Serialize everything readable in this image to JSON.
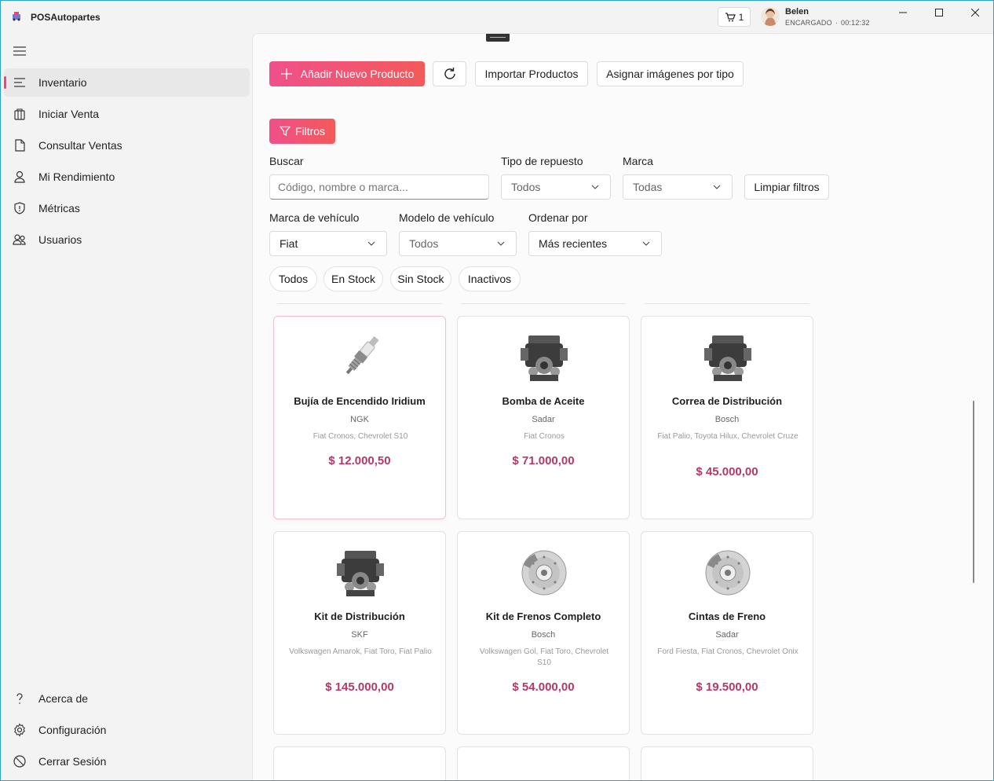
{
  "app": {
    "title": "POSAutopartes"
  },
  "header": {
    "cart_count": "1",
    "user_name": "Belen",
    "user_role": "ENCARGADO",
    "session_time": "00:12:32"
  },
  "sidebar": {
    "items": [
      {
        "label": "Inventario",
        "icon": "list-icon",
        "active": true
      },
      {
        "label": "Iniciar Venta",
        "icon": "bag-icon"
      },
      {
        "label": "Consultar Ventas",
        "icon": "document-icon"
      },
      {
        "label": "Mi Rendimiento",
        "icon": "user-icon"
      },
      {
        "label": "Métricas",
        "icon": "shield-icon"
      },
      {
        "label": "Usuarios",
        "icon": "users-icon"
      }
    ],
    "bottom": [
      {
        "label": "Acerca de",
        "icon": "question-icon"
      },
      {
        "label": "Configuración",
        "icon": "gear-icon"
      },
      {
        "label": "Cerrar Sesión",
        "icon": "logout-icon"
      }
    ]
  },
  "toolbar": {
    "add_label": "Añadir Nuevo Producto",
    "import_label": "Importar Productos",
    "assign_label": "Asignar imágenes por tipo",
    "filters_label": "Filtros"
  },
  "filters": {
    "search_label": "Buscar",
    "search_placeholder": "Código, nombre o marca...",
    "part_type_label": "Tipo de repuesto",
    "part_type_value": "Todos",
    "brand_label": "Marca",
    "brand_value": "Todas",
    "clear_label": "Limpiar filtros",
    "vehicle_brand_label": "Marca de vehículo",
    "vehicle_brand_value": "Fiat",
    "vehicle_model_label": "Modelo de vehículo",
    "vehicle_model_value": "Todos",
    "sort_label": "Ordenar por",
    "sort_value": "Más recientes",
    "chips": [
      "Todos",
      "En Stock",
      "Sin Stock",
      "Inactivos"
    ]
  },
  "products": [
    {
      "name": "Bujía de Encendido Iridium",
      "brand": "NGK",
      "models": "Fiat Cronos, Chevrolet S10",
      "price": "$ 12.000,50",
      "image": "spark-plug"
    },
    {
      "name": "Bomba de Aceite",
      "brand": "Sadar",
      "models": "Fiat Cronos",
      "price": "$ 71.000,00",
      "image": "engine"
    },
    {
      "name": "Correa de Distribución",
      "brand": "Bosch",
      "models": "Fiat Palio, Toyota Hilux, Chevrolet Cruze",
      "price": "$ 45.000,00",
      "image": "engine"
    },
    {
      "name": "Kit de Distribución",
      "brand": "SKF",
      "models": "Volkswagen Amarok, Fiat Toro, Fiat Palio",
      "price": "$ 145.000,00",
      "image": "engine"
    },
    {
      "name": "Kit de Frenos Completo",
      "brand": "Bosch",
      "models": "Volkswagen Gol, Fiat Toro, Chevrolet S10",
      "price": "$ 54.000,00",
      "image": "brake-disc"
    },
    {
      "name": "Cintas de Freno",
      "brand": "Sadar",
      "models": "Ford Fiesta, Fiat Cronos, Chevrolet Onix",
      "price": "$ 19.500,00",
      "image": "brake-disc"
    }
  ],
  "colors": {
    "accent": "#e64980",
    "price": "#b03a6a"
  }
}
